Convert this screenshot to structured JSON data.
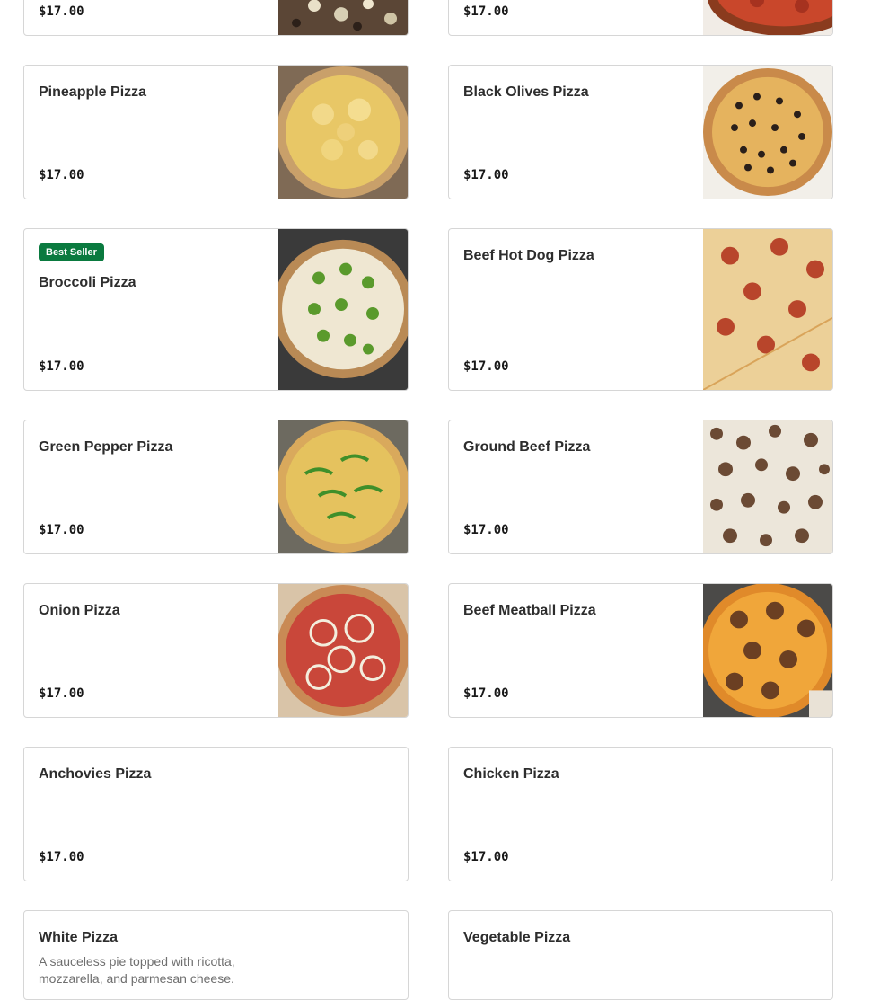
{
  "menu": {
    "badge_best_seller": "Best Seller",
    "items": [
      {
        "name": "",
        "price": "$17.00"
      },
      {
        "name": "",
        "price": "$17.00"
      },
      {
        "name": "Pineapple Pizza",
        "price": "$17.00",
        "image_icon": "pineapple-pizza-photo"
      },
      {
        "name": "Black Olives Pizza",
        "price": "$17.00",
        "image_icon": "black-olives-pizza-photo"
      },
      {
        "name": "Broccoli Pizza",
        "price": "$17.00",
        "badge": "Best Seller",
        "image_icon": "broccoli-pizza-photo"
      },
      {
        "name": "Beef Hot Dog Pizza",
        "price": "$17.00",
        "image_icon": "hot-dog-pizza-photo"
      },
      {
        "name": "Green Pepper Pizza",
        "price": "$17.00",
        "image_icon": "green-pepper-pizza-photo"
      },
      {
        "name": "Ground Beef Pizza",
        "price": "$17.00",
        "image_icon": "ground-beef-pizza-photo"
      },
      {
        "name": "Onion Pizza",
        "price": "$17.00",
        "image_icon": "onion-pizza-photo"
      },
      {
        "name": "Beef Meatball Pizza",
        "price": "$17.00",
        "image_icon": "meatball-pizza-photo"
      },
      {
        "name": "Anchovies Pizza",
        "price": "$17.00"
      },
      {
        "name": "Chicken Pizza",
        "price": "$17.00"
      },
      {
        "name": "White Pizza",
        "description": "A sauceless pie topped with ricotta, mozzarella, and parmesan cheese."
      },
      {
        "name": "Vegetable Pizza"
      }
    ]
  },
  "colors": {
    "badge_green": "#0a7a3f",
    "card_border": "#d6d6d6",
    "text_primary": "#2d2d2d",
    "text_secondary": "#6f6f6f"
  }
}
